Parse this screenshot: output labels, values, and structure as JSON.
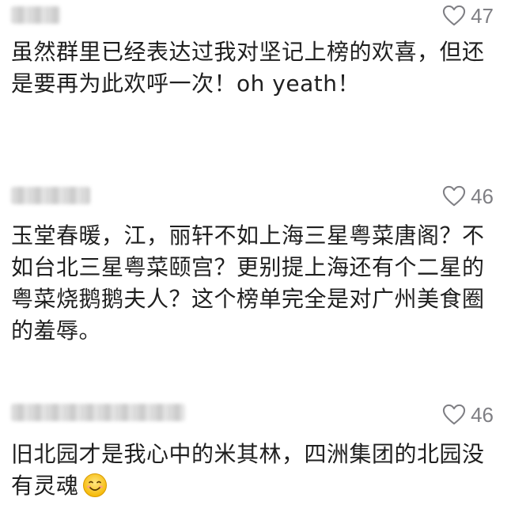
{
  "comments": [
    {
      "likes": "47",
      "text": "虽然群里已经表达过我对坚记上榜的欢喜，但还是要再为此欢呼一次！oh yeath！"
    },
    {
      "likes": "46",
      "text": "玉堂春暖，江，丽轩不如上海三星粤菜唐阁？不如台北三星粤菜颐宫？更别提上海还有个二星的粤菜烧鹅鹅夫人？这个榜单完全是对广州美食圈的羞辱。"
    },
    {
      "likes": "46",
      "text": "旧北园才是我心中的米其林，四洲集团的北园没有灵魂",
      "emoji": "smiling-face-icon"
    }
  ],
  "colors": {
    "text": "#1f1f1f",
    "like_gray": "#7f7f84",
    "background": "#ffffff"
  }
}
